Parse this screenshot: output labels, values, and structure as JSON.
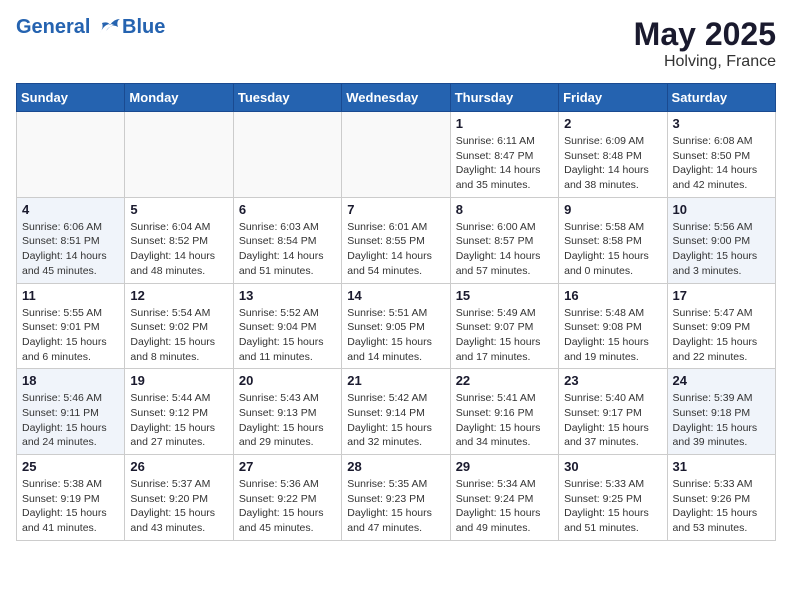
{
  "header": {
    "logo_line1": "General",
    "logo_line2": "Blue",
    "month_year": "May 2025",
    "location": "Holving, France"
  },
  "days_of_week": [
    "Sunday",
    "Monday",
    "Tuesday",
    "Wednesday",
    "Thursday",
    "Friday",
    "Saturday"
  ],
  "weeks": [
    [
      {
        "num": "",
        "info": ""
      },
      {
        "num": "",
        "info": ""
      },
      {
        "num": "",
        "info": ""
      },
      {
        "num": "",
        "info": ""
      },
      {
        "num": "1",
        "info": "Sunrise: 6:11 AM\nSunset: 8:47 PM\nDaylight: 14 hours\nand 35 minutes."
      },
      {
        "num": "2",
        "info": "Sunrise: 6:09 AM\nSunset: 8:48 PM\nDaylight: 14 hours\nand 38 minutes."
      },
      {
        "num": "3",
        "info": "Sunrise: 6:08 AM\nSunset: 8:50 PM\nDaylight: 14 hours\nand 42 minutes."
      }
    ],
    [
      {
        "num": "4",
        "info": "Sunrise: 6:06 AM\nSunset: 8:51 PM\nDaylight: 14 hours\nand 45 minutes."
      },
      {
        "num": "5",
        "info": "Sunrise: 6:04 AM\nSunset: 8:52 PM\nDaylight: 14 hours\nand 48 minutes."
      },
      {
        "num": "6",
        "info": "Sunrise: 6:03 AM\nSunset: 8:54 PM\nDaylight: 14 hours\nand 51 minutes."
      },
      {
        "num": "7",
        "info": "Sunrise: 6:01 AM\nSunset: 8:55 PM\nDaylight: 14 hours\nand 54 minutes."
      },
      {
        "num": "8",
        "info": "Sunrise: 6:00 AM\nSunset: 8:57 PM\nDaylight: 14 hours\nand 57 minutes."
      },
      {
        "num": "9",
        "info": "Sunrise: 5:58 AM\nSunset: 8:58 PM\nDaylight: 15 hours\nand 0 minutes."
      },
      {
        "num": "10",
        "info": "Sunrise: 5:56 AM\nSunset: 9:00 PM\nDaylight: 15 hours\nand 3 minutes."
      }
    ],
    [
      {
        "num": "11",
        "info": "Sunrise: 5:55 AM\nSunset: 9:01 PM\nDaylight: 15 hours\nand 6 minutes."
      },
      {
        "num": "12",
        "info": "Sunrise: 5:54 AM\nSunset: 9:02 PM\nDaylight: 15 hours\nand 8 minutes."
      },
      {
        "num": "13",
        "info": "Sunrise: 5:52 AM\nSunset: 9:04 PM\nDaylight: 15 hours\nand 11 minutes."
      },
      {
        "num": "14",
        "info": "Sunrise: 5:51 AM\nSunset: 9:05 PM\nDaylight: 15 hours\nand 14 minutes."
      },
      {
        "num": "15",
        "info": "Sunrise: 5:49 AM\nSunset: 9:07 PM\nDaylight: 15 hours\nand 17 minutes."
      },
      {
        "num": "16",
        "info": "Sunrise: 5:48 AM\nSunset: 9:08 PM\nDaylight: 15 hours\nand 19 minutes."
      },
      {
        "num": "17",
        "info": "Sunrise: 5:47 AM\nSunset: 9:09 PM\nDaylight: 15 hours\nand 22 minutes."
      }
    ],
    [
      {
        "num": "18",
        "info": "Sunrise: 5:46 AM\nSunset: 9:11 PM\nDaylight: 15 hours\nand 24 minutes."
      },
      {
        "num": "19",
        "info": "Sunrise: 5:44 AM\nSunset: 9:12 PM\nDaylight: 15 hours\nand 27 minutes."
      },
      {
        "num": "20",
        "info": "Sunrise: 5:43 AM\nSunset: 9:13 PM\nDaylight: 15 hours\nand 29 minutes."
      },
      {
        "num": "21",
        "info": "Sunrise: 5:42 AM\nSunset: 9:14 PM\nDaylight: 15 hours\nand 32 minutes."
      },
      {
        "num": "22",
        "info": "Sunrise: 5:41 AM\nSunset: 9:16 PM\nDaylight: 15 hours\nand 34 minutes."
      },
      {
        "num": "23",
        "info": "Sunrise: 5:40 AM\nSunset: 9:17 PM\nDaylight: 15 hours\nand 37 minutes."
      },
      {
        "num": "24",
        "info": "Sunrise: 5:39 AM\nSunset: 9:18 PM\nDaylight: 15 hours\nand 39 minutes."
      }
    ],
    [
      {
        "num": "25",
        "info": "Sunrise: 5:38 AM\nSunset: 9:19 PM\nDaylight: 15 hours\nand 41 minutes."
      },
      {
        "num": "26",
        "info": "Sunrise: 5:37 AM\nSunset: 9:20 PM\nDaylight: 15 hours\nand 43 minutes."
      },
      {
        "num": "27",
        "info": "Sunrise: 5:36 AM\nSunset: 9:22 PM\nDaylight: 15 hours\nand 45 minutes."
      },
      {
        "num": "28",
        "info": "Sunrise: 5:35 AM\nSunset: 9:23 PM\nDaylight: 15 hours\nand 47 minutes."
      },
      {
        "num": "29",
        "info": "Sunrise: 5:34 AM\nSunset: 9:24 PM\nDaylight: 15 hours\nand 49 minutes."
      },
      {
        "num": "30",
        "info": "Sunrise: 5:33 AM\nSunset: 9:25 PM\nDaylight: 15 hours\nand 51 minutes."
      },
      {
        "num": "31",
        "info": "Sunrise: 5:33 AM\nSunset: 9:26 PM\nDaylight: 15 hours\nand 53 minutes."
      }
    ]
  ]
}
